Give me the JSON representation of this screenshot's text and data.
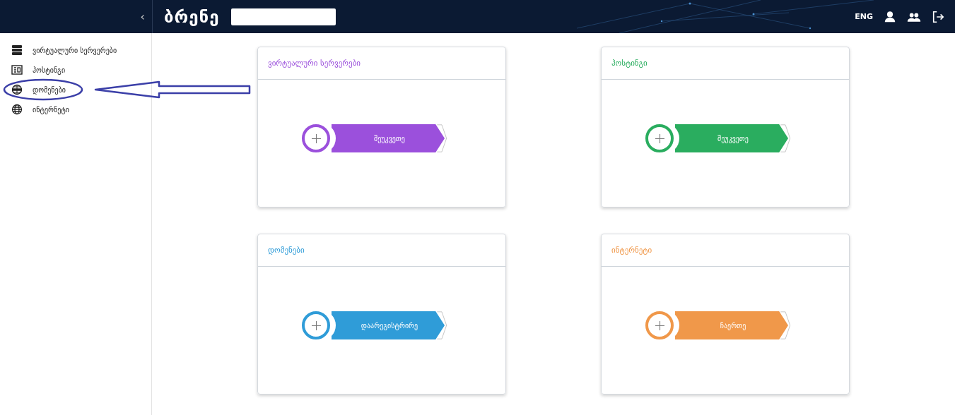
{
  "header": {
    "collapse_toggle": "‹",
    "logo": "ბრენე",
    "language": "ENG"
  },
  "sidebar": {
    "items": [
      {
        "label": "ვირტუალური სერვერები",
        "highlighted": false
      },
      {
        "label": "ჰოსტინგი",
        "highlighted": false
      },
      {
        "label": "დომენები",
        "highlighted": true
      },
      {
        "label": "ინტერნეტი",
        "highlighted": false
      }
    ]
  },
  "cards": [
    {
      "title": "ვირტუალური სერვერები",
      "button": "შეუკვეთე",
      "color": "#9b50dc"
    },
    {
      "title": "ჰოსტინგი",
      "button": "შეუკვეთე",
      "color": "#2aad5f"
    },
    {
      "title": "დომენები",
      "button": "დაარეგისტრირე",
      "color": "#2f9cd8"
    },
    {
      "title": "ინტერნეტი",
      "button": "ჩაერთე",
      "color": "#f0984a"
    }
  ]
}
